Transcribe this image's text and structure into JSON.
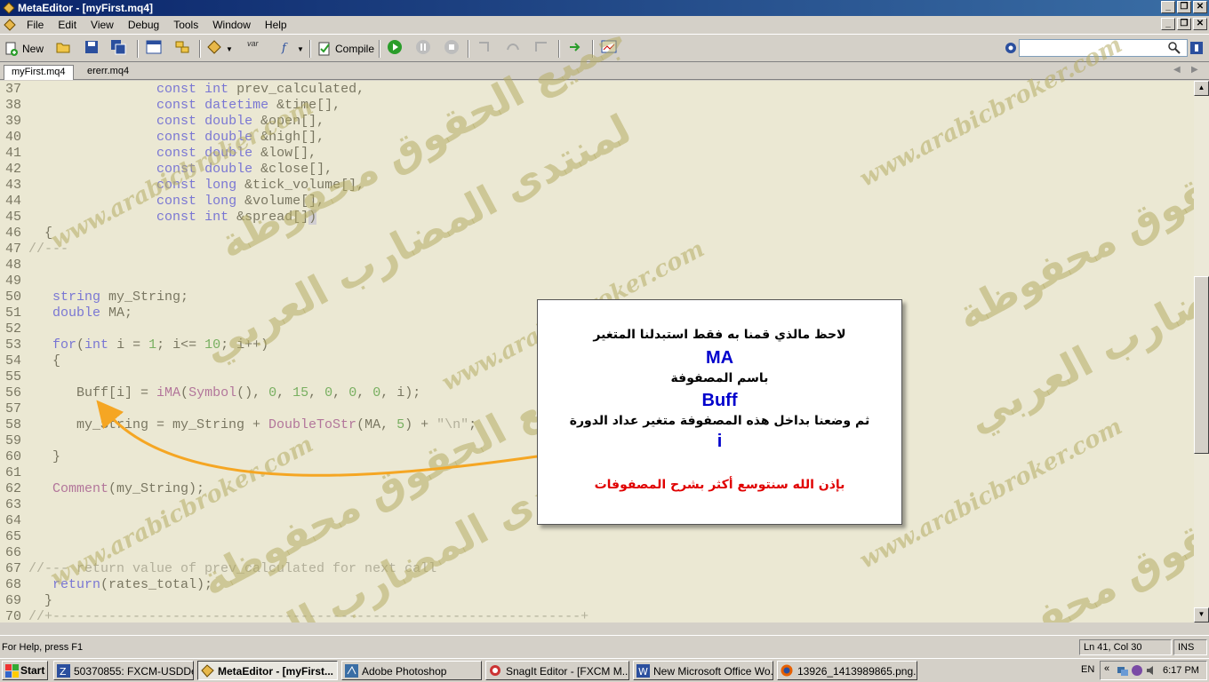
{
  "window": {
    "title": "MetaEditor - [myFirst.mq4]"
  },
  "menu": [
    "File",
    "Edit",
    "View",
    "Debug",
    "Tools",
    "Window",
    "Help"
  ],
  "toolbar": {
    "new_label": "New",
    "compile_label": "Compile",
    "var_label": "var"
  },
  "tabs": [
    {
      "label": "myFirst.mq4",
      "active": true
    },
    {
      "label": "ererr.mq4",
      "active": false
    }
  ],
  "code_lines": [
    {
      "n": "37",
      "html": "                <span class=\"kw\">const</span> <span class=\"kw\">int</span> prev_calculated,"
    },
    {
      "n": "38",
      "html": "                <span class=\"kw\">const</span> <span class=\"kw\">datetime</span> &amp;time[],"
    },
    {
      "n": "39",
      "html": "                <span class=\"kw\">const</span> <span class=\"kw\">double</span> &amp;open[],"
    },
    {
      "n": "40",
      "html": "                <span class=\"kw\">const</span> <span class=\"kw\">double</span> &amp;high[],"
    },
    {
      "n": "41",
      "html": "                <span class=\"kw\">const</span> <span class=\"kw\">double</span> &amp;low[],"
    },
    {
      "n": "42",
      "html": "                <span class=\"kw\">const</span> <span class=\"kw\">double</span> &amp;close[],"
    },
    {
      "n": "43",
      "html": "                <span class=\"kw\">const</span> <span class=\"kw\">long</span> &amp;tick_volume[],"
    },
    {
      "n": "44",
      "html": "                <span class=\"kw\">const</span> <span class=\"kw\">long</span> &amp;volume[],"
    },
    {
      "n": "45",
      "html": "                <span class=\"kw\">const</span> <span class=\"kw\">int</span> &amp;spread[]<span class=\"brace\">)</span>"
    },
    {
      "n": "46",
      "html": "  {"
    },
    {
      "n": "47",
      "html": "<span class=\"cm\">//---</span>"
    },
    {
      "n": "48",
      "html": ""
    },
    {
      "n": "49",
      "html": ""
    },
    {
      "n": "50",
      "html": "   <span class=\"kw\">string</span> my_String;"
    },
    {
      "n": "51",
      "html": "   <span class=\"kw\">double</span> MA;"
    },
    {
      "n": "52",
      "html": ""
    },
    {
      "n": "53",
      "html": "   <span class=\"kw\">for</span>(<span class=\"kw\">int</span> i = <span class=\"num\">1</span>; i&lt;= <span class=\"num\">10</span>; i++)"
    },
    {
      "n": "54",
      "html": "   {"
    },
    {
      "n": "55",
      "html": ""
    },
    {
      "n": "56",
      "html": "      Buff[i] = <span class=\"fn\">iMA</span>(<span class=\"fn\">Symbol</span>(), <span class=\"num\">0</span>, <span class=\"num\">15</span>, <span class=\"num\">0</span>, <span class=\"num\">0</span>, <span class=\"num\">0</span>, i);"
    },
    {
      "n": "57",
      "html": ""
    },
    {
      "n": "58",
      "html": "      my_String = my_String + <span class=\"fn\">DoubleToStr</span>(MA, <span class=\"num\">5</span>) + <span class=\"str\">\"\\n\"</span>;"
    },
    {
      "n": "59",
      "html": ""
    },
    {
      "n": "60",
      "html": "   }"
    },
    {
      "n": "61",
      "html": ""
    },
    {
      "n": "62",
      "html": "   <span class=\"fn\">Comment</span>(my_String);"
    },
    {
      "n": "63",
      "html": ""
    },
    {
      "n": "64",
      "html": ""
    },
    {
      "n": "65",
      "html": ""
    },
    {
      "n": "66",
      "html": ""
    },
    {
      "n": "67",
      "html": "<span class=\"cm\">//--- return value of prev_calculated for next call</span>"
    },
    {
      "n": "68",
      "html": "   <span class=\"kw\">return</span>(rates_total);"
    },
    {
      "n": "69",
      "html": "  }"
    },
    {
      "n": "70",
      "html": "<span class=\"cm\">//+------------------------------------------------------------------+</span>"
    }
  ],
  "callout": {
    "line1": "لاحظ مالذي قمنا به فقط استبدلنا المتغير",
    "term1": "MA",
    "line2": "باسم المصفوفة",
    "term2": "Buff",
    "line3": "ثم وضعنا بداخل هذه المصفوفة متغير عداد الدورة",
    "term3": "i",
    "note": "بإذن الله سنتوسع أكثر بشرح المصفوفات"
  },
  "watermark": {
    "site": "www.arabicbroker.com",
    "rights": "جميع الحقوق محفوظة",
    "forum": "لمنتدى المضارب العربي"
  },
  "statusbar": {
    "help": "For Help, press F1",
    "position": "Ln 41, Col 30",
    "mode": "INS"
  },
  "taskbar": {
    "start": "Start",
    "tasks": [
      {
        "label": "50370855: FXCM-USDDe...",
        "active": false
      },
      {
        "label": "MetaEditor - [myFirst...",
        "active": true
      },
      {
        "label": "Adobe Photoshop",
        "active": false
      },
      {
        "label": "SnagIt Editor - [FXCM M...",
        "active": false
      },
      {
        "label": "New Microsoft Office Wo...",
        "active": false
      },
      {
        "label": "13926_1413989865.png...",
        "active": false
      }
    ],
    "lang": "EN",
    "time": "6:17 PM"
  },
  "colors": {
    "keyword": "#0000ff",
    "function": "#800080",
    "number": "#008000",
    "callout_term": "#0000cc",
    "callout_note": "#e00000",
    "arrow": "#f5a623"
  }
}
